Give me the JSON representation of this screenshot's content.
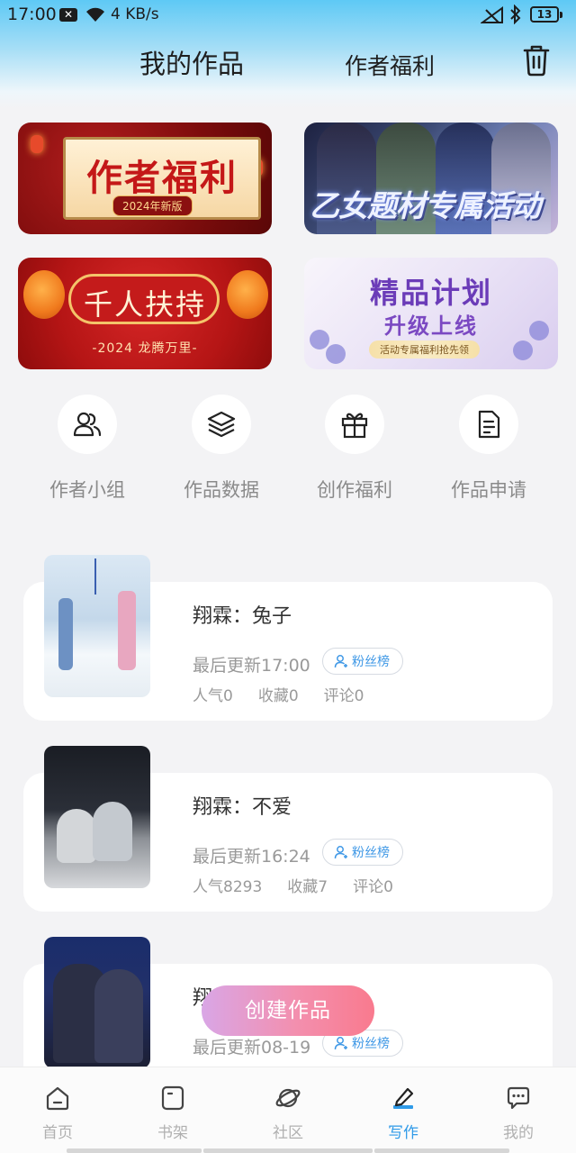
{
  "status_bar": {
    "time": "17:00",
    "net_speed": "4 KB/s",
    "battery": "13"
  },
  "header": {
    "tab_my_works": "我的作品",
    "tab_author_welfare": "作者福利"
  },
  "banners": [
    {
      "title": "作者福利",
      "tag": "2024年新版"
    },
    {
      "title": "乙女题材专属活动"
    },
    {
      "title": "千人扶持",
      "subtitle": "-2024 龙腾万里-"
    },
    {
      "title": "精品计划",
      "subtitle": "升级上线",
      "tag": "活动专属福利抢先领"
    }
  ],
  "quick_entries": [
    {
      "label": "作者小组",
      "icon": "users-icon"
    },
    {
      "label": "作品数据",
      "icon": "layers-icon"
    },
    {
      "label": "创作福利",
      "icon": "gift-icon"
    },
    {
      "label": "作品申请",
      "icon": "document-icon"
    }
  ],
  "works": [
    {
      "title": "翔霖：兔子",
      "updated": "最后更新17:00",
      "fans_label": "粉丝榜",
      "popularity": "人气0",
      "favorites": "收藏0",
      "comments": "评论0"
    },
    {
      "title": "翔霖：不爱",
      "updated": "最后更新16:24",
      "fans_label": "粉丝榜",
      "popularity": "人气8293",
      "favorites": "收藏7",
      "comments": "评论0"
    },
    {
      "title": "翔",
      "updated": "最后更新08-19",
      "fans_label": "粉丝榜"
    }
  ],
  "create_button": "创建作品",
  "bottom_nav": [
    {
      "label": "首页",
      "icon": "home-icon"
    },
    {
      "label": "书架",
      "icon": "bookshelf-icon"
    },
    {
      "label": "社区",
      "icon": "planet-icon"
    },
    {
      "label": "写作",
      "icon": "pen-icon",
      "active": true
    },
    {
      "label": "我的",
      "icon": "chat-bubble-icon"
    }
  ],
  "colors": {
    "accent": "#2f9ae8",
    "create_gradient_start": "#d9a6e6",
    "create_gradient_end": "#f97a8e"
  }
}
